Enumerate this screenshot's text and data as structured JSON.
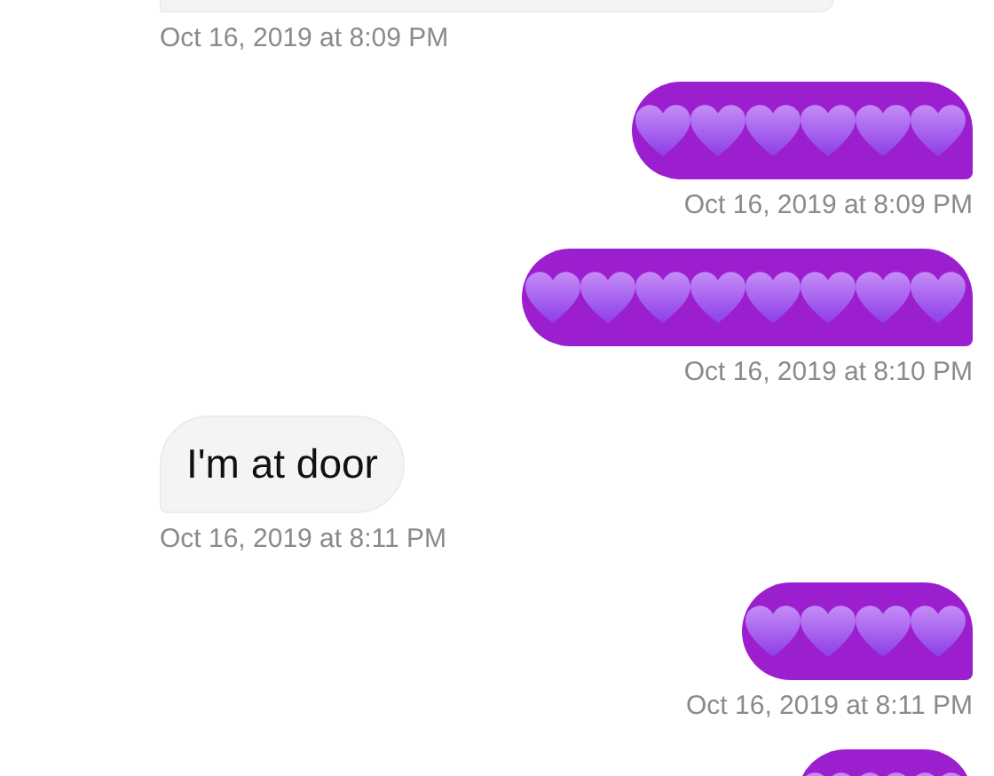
{
  "messages": [
    {
      "kind": "received",
      "time": "Oct 16, 2019 at 8:09 PM"
    },
    {
      "kind": "sent",
      "hearts": [
        {
          "kind": "heart"
        },
        {
          "kind": "heart"
        },
        {
          "kind": "heart"
        },
        {
          "kind": "heart"
        },
        {
          "kind": "heart"
        },
        {
          "kind": "heart"
        }
      ],
      "time": "Oct 16, 2019 at 8:09 PM"
    },
    {
      "kind": "sent",
      "hearts": [
        {
          "kind": "heart"
        },
        {
          "kind": "heart"
        },
        {
          "kind": "heart"
        },
        {
          "kind": "heart"
        },
        {
          "kind": "heart"
        },
        {
          "kind": "heart"
        },
        {
          "kind": "heart"
        },
        {
          "kind": "heart"
        }
      ],
      "time": "Oct 16, 2019 at 8:10 PM"
    },
    {
      "kind": "received",
      "text": "I'm at door",
      "time": "Oct 16, 2019 at 8:11 PM"
    },
    {
      "kind": "sent",
      "hearts": [
        {
          "kind": "heart"
        },
        {
          "kind": "heart"
        },
        {
          "kind": "heart"
        },
        {
          "kind": "heart"
        }
      ],
      "time": "Oct 16, 2019 at 8:11 PM"
    },
    {
      "kind": "sent",
      "hearts": [
        {
          "kind": "heart"
        },
        {
          "kind": "heart"
        },
        {
          "kind": "heart"
        }
      ]
    }
  ]
}
